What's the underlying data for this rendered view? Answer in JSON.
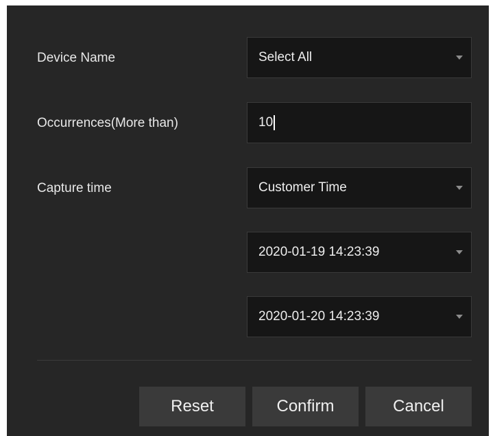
{
  "form": {
    "device_name": {
      "label": "Device Name",
      "value": "Select All"
    },
    "occurrences": {
      "label": "Occurrences(More than)",
      "value": "10"
    },
    "capture_time": {
      "label": "Capture time",
      "mode": "Customer Time",
      "start": "2020-01-19 14:23:39",
      "end": "2020-01-20 14:23:39"
    }
  },
  "buttons": {
    "reset": "Reset",
    "confirm": "Confirm",
    "cancel": "Cancel"
  },
  "icons": {
    "dropdown": "chevron-down-icon"
  },
  "colors": {
    "background": "#262626",
    "field_background": "#161616",
    "button_background": "#3a3a3a",
    "text": "#e6e6e6"
  }
}
